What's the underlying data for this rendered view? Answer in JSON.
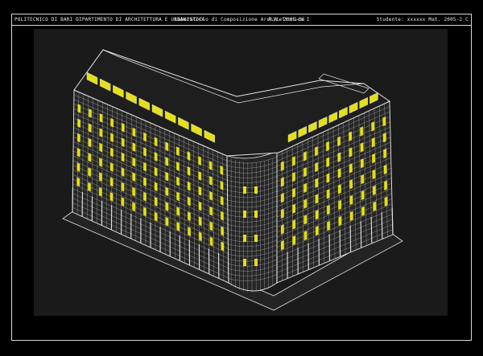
{
  "titlebar": {
    "institution": "POLITECNICO DI BARI  DIPARTIMENTO DI ARCHITETTURA E URBANISTICA",
    "course": "Laboratorio di Composizione Architettonica I",
    "year": "A.A. 2005-06",
    "student": "Studente: xxxxxx  Mat. 2005-2 C"
  },
  "drawing": {
    "line_color": "#e6e6e6",
    "window_color": "#e3e01a",
    "background": "#1a1a1a",
    "subject": "axonometric-building-wireframe"
  }
}
